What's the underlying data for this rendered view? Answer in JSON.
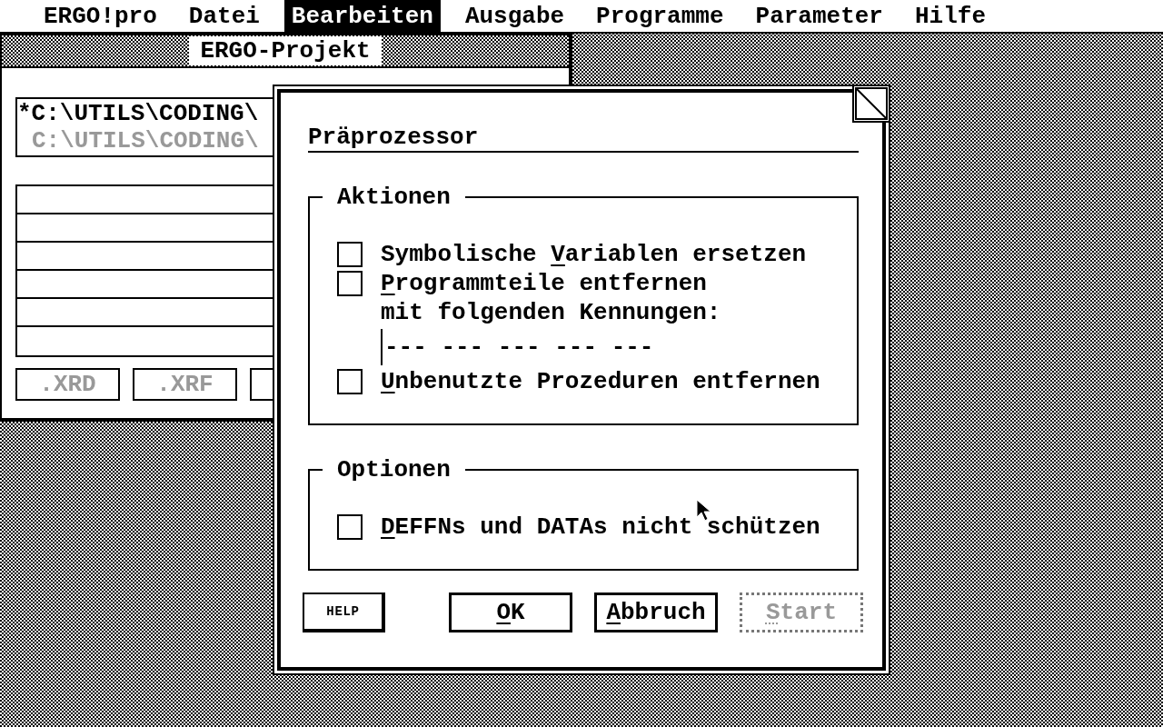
{
  "menu_bar": [
    {
      "label": "ERGO!pro",
      "selected": false
    },
    {
      "label": "Datei",
      "selected": false
    },
    {
      "label": "Bearbeiten",
      "selected": true
    },
    {
      "label": "Ausgabe",
      "selected": false
    },
    {
      "label": "Programme",
      "selected": false
    },
    {
      "label": "Parameter",
      "selected": false
    },
    {
      "label": "Hilfe",
      "selected": false
    }
  ],
  "project_window": {
    "title": "ERGO-Projekt",
    "files": [
      {
        "path": "*C:\\UTILS\\CODING\\",
        "disabled": false
      },
      {
        "path": "C:\\UTILS\\CODING\\",
        "disabled": true
      }
    ],
    "buttons": [
      {
        "label": ".XRD",
        "disabled": true
      },
      {
        "label": ".XRF",
        "disabled": true
      }
    ]
  },
  "dialog": {
    "title": "Präprozessor",
    "groups": [
      {
        "title": "Aktionen",
        "items": [
          {
            "kind": "checkbox",
            "checked": false,
            "label": [
              {
                "text": "Symbolische ",
                "underlined": false
              },
              {
                "text": "V",
                "underlined": true
              },
              {
                "text": "ariablen ersetzen",
                "underlined": false
              }
            ]
          },
          {
            "kind": "checkbox",
            "checked": false,
            "label": [
              {
                "text": "P",
                "underlined": true
              },
              {
                "text": "rogrammteile entfernen",
                "underlined": false
              }
            ]
          },
          {
            "kind": "text",
            "text": "mit folgenden Kennungen:"
          },
          {
            "kind": "field",
            "placeholder": "--- --- --- --- ---"
          },
          {
            "kind": "checkbox",
            "checked": false,
            "label": [
              {
                "text": "U",
                "underlined": true
              },
              {
                "text": "nbenutzte Prozeduren entfernen",
                "underlined": false
              }
            ]
          }
        ]
      },
      {
        "title": "Optionen",
        "items": [
          {
            "kind": "checkbox",
            "checked": false,
            "label": [
              {
                "text": "D",
                "underlined": true
              },
              {
                "text": "EFFNs und DATAs nicht schützen",
                "underlined": false
              }
            ]
          }
        ]
      }
    ],
    "buttons": [
      {
        "kind": "help",
        "disabled": false,
        "label": "HELP"
      },
      {
        "kind": "button",
        "disabled": false,
        "label": [
          {
            "text": "O",
            "underlined": true
          },
          {
            "text": "K",
            "underlined": false
          }
        ]
      },
      {
        "kind": "button",
        "disabled": false,
        "label": [
          {
            "text": "A",
            "underlined": true
          },
          {
            "text": "bbruch",
            "underlined": false
          }
        ]
      },
      {
        "kind": "button",
        "disabled": true,
        "label": [
          {
            "text": "S",
            "underlined": true
          },
          {
            "text": "tart",
            "underlined": false
          }
        ]
      }
    ]
  }
}
